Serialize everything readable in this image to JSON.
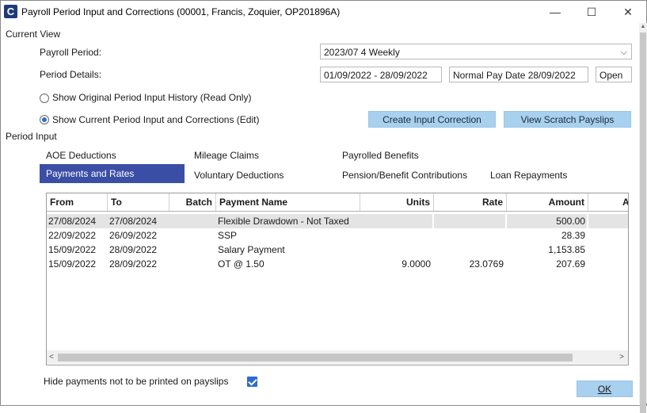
{
  "window": {
    "title": "Payroll Period Input and Corrections (00001, Francis, Zoquier, OP201896A)",
    "app_icon": "C",
    "minimize_icon": "—",
    "maximize_icon": "☐",
    "close_icon": "✕"
  },
  "current_view": {
    "section_label": "Current View",
    "payroll_period_label": "Payroll Period:",
    "payroll_period_value": "2023/07 4 Weekly",
    "period_details_label": "Period Details:",
    "period_dates": "01/09/2022 - 28/09/2022",
    "normal_pay_date": "Normal Pay Date 28/09/2022",
    "period_status": "Open",
    "radio_original": "Show Original Period Input History (Read Only)",
    "radio_current": "Show Current Period Input and Corrections (Edit)",
    "create_correction_button": "Create Input Correction",
    "view_scratch_button": "View Scratch Payslips"
  },
  "period_input": {
    "section_label": "Period Input",
    "tabs": [
      "AOE Deductions",
      "Mileage Claims",
      "Payrolled Benefits",
      "Payments and Rates",
      "Voluntary Deductions",
      "Pension/Benefit Contributions",
      "Loan Repayments"
    ],
    "active_tab": "Payments and Rates"
  },
  "table": {
    "columns": [
      "From",
      "To",
      "Batch",
      "Payment Name",
      "Units",
      "Rate",
      "Amount",
      "A"
    ],
    "rows": [
      {
        "from": "27/08/2024",
        "to": "27/08/2024",
        "batch": "",
        "payment_name": "Flexible Drawdown - Not Taxed",
        "units": "",
        "rate": "",
        "amount": "500.00"
      },
      {
        "from": "22/09/2022",
        "to": "26/09/2022",
        "batch": "",
        "payment_name": "SSP",
        "units": "",
        "rate": "",
        "amount": "28.39"
      },
      {
        "from": "15/09/2022",
        "to": "28/09/2022",
        "batch": "",
        "payment_name": "Salary Payment",
        "units": "",
        "rate": "",
        "amount": "1,153.85"
      },
      {
        "from": "15/09/2022",
        "to": "28/09/2022",
        "batch": "",
        "payment_name": "OT @ 1.50",
        "units": "9.0000",
        "rate": "23.0769",
        "amount": "207.69"
      }
    ]
  },
  "footer": {
    "hide_payments_label": "Hide payments not to be printed on payslips",
    "hide_payments_checked": true,
    "ok_button": "OK"
  },
  "colors": {
    "active_tab": "#3b4ea6",
    "button_blue": "#a8d0ef",
    "app_icon": "#1f3a7a",
    "checkbox": "#2d6bd0"
  }
}
